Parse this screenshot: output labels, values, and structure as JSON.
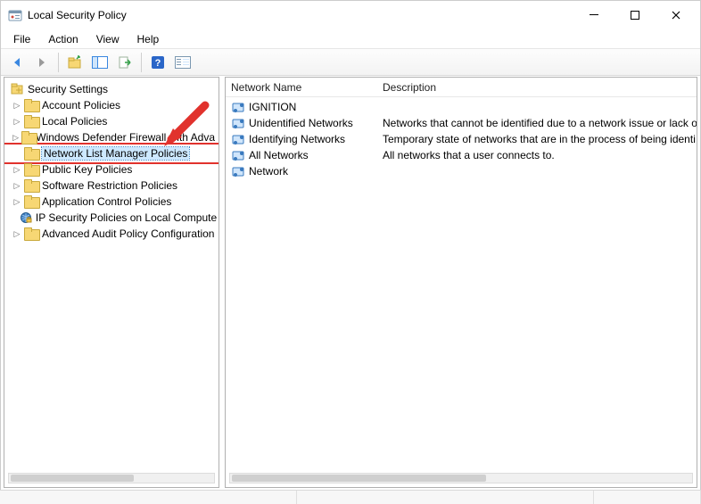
{
  "window": {
    "title": "Local Security Policy"
  },
  "menu": {
    "items": [
      "File",
      "Action",
      "View",
      "Help"
    ]
  },
  "toolbar": {
    "buttons": [
      {
        "name": "back-icon",
        "glyph": "arrow-left",
        "color": "#3a87e0"
      },
      {
        "name": "forward-icon",
        "glyph": "arrow-right",
        "color": "#9a9a9a"
      },
      {
        "name": "up-icon",
        "glyph": "folder-up",
        "color": "#f2c84b"
      },
      {
        "name": "show-hide-tree-icon",
        "glyph": "panes",
        "color": "#3a87e0"
      },
      {
        "name": "export-list-icon",
        "glyph": "export",
        "color": "#35a24a"
      },
      {
        "name": "help-icon",
        "glyph": "help",
        "color": "#2a66c8"
      },
      {
        "name": "properties-icon",
        "glyph": "props",
        "color": "#3a87e0"
      }
    ]
  },
  "tree": {
    "root": "Security Settings",
    "items": [
      {
        "label": "Account Policies",
        "expandable": true
      },
      {
        "label": "Local Policies",
        "expandable": true
      },
      {
        "label": "Windows Defender Firewall with Adva",
        "expandable": true
      },
      {
        "label": "Network List Manager Policies",
        "expandable": false,
        "selected": true,
        "highlighted": true
      },
      {
        "label": "Public Key Policies",
        "expandable": true
      },
      {
        "label": "Software Restriction Policies",
        "expandable": true
      },
      {
        "label": "Application Control Policies",
        "expandable": true
      },
      {
        "label": "IP Security Policies on Local Compute",
        "expandable": false,
        "icon": "shield"
      },
      {
        "label": "Advanced Audit Policy Configuration",
        "expandable": true
      }
    ]
  },
  "list": {
    "columns": {
      "name": "Network Name",
      "description": "Description"
    },
    "rows": [
      {
        "name": "IGNITION",
        "description": ""
      },
      {
        "name": "Unidentified Networks",
        "description": "Networks that cannot be identified due to a network issue or lack o"
      },
      {
        "name": "Identifying Networks",
        "description": "Temporary state of networks that are in the process of being identi"
      },
      {
        "name": "All Networks",
        "description": "All networks that a user connects to."
      },
      {
        "name": "Network",
        "description": ""
      }
    ]
  },
  "annotation": {
    "arrow_color": "#e1322d"
  }
}
